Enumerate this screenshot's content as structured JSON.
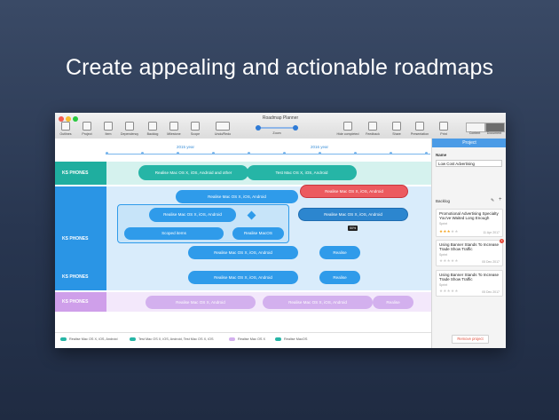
{
  "headline": "Create appealing and actionable roadmaps",
  "window": {
    "title": "Roadmap Planner"
  },
  "toolbar": {
    "outlines": "Outlines",
    "project": "Project",
    "item": "Item",
    "dependency": "Dependency",
    "backlog": "Backlog",
    "milestone": "Milestone",
    "scope": "Scope",
    "undo_redo": "Undo/Redo",
    "zoom": "Zoom",
    "hide_completed": "Hide completed",
    "feedback": "Feedback",
    "share": "Share",
    "presentation": "Presentation",
    "print": "Print",
    "content": "Content",
    "document": "Document"
  },
  "timeline": {
    "year1": "2015 year",
    "year2": "2016 year"
  },
  "lanes": {
    "ks1": {
      "label": "KS PHONES",
      "bar1": "Realise Mac OS X, iOS, Android and other",
      "bar2": "Test Mac OS X, iOS, Android"
    },
    "ks2": {
      "label": "KS PHONES",
      "bar_top": "Realise Mac OS X, iOS, Android",
      "bar_red": "Realise Mac OS X, iOS, Android",
      "bar_grp": "Realise Mac OS X, iOS, Android",
      "bar_sel": "Realise Mac OS X, iOS, Android",
      "scoped": "Scoped items",
      "macos": "Realise MacOS",
      "bar_bottom": "Realise Mac OS X, iOS, Android",
      "realise": "Realise",
      "percent_tag": "50%"
    },
    "ks3": {
      "label": "KS PHONES",
      "bar1": "Realise Mac OS X, iOS, Android",
      "bar2": "Realise"
    },
    "ks4": {
      "label": "KS PHONES",
      "bar1": "Realise Mac OS X, Android",
      "bar2": "Realise Mac OS X, iOS, Android",
      "bar3": "Realise"
    }
  },
  "legend": [
    {
      "label": "Realise Mac OS X, iOS, Android",
      "color": "#26b5a6"
    },
    {
      "label": "Test Mac OS X, iOS, Android, Test Mac OS X, iOS",
      "color": "#26b5a6"
    },
    {
      "label": "Realise Mac OS X",
      "color": "#d3b0ee"
    },
    {
      "label": "Realise MacOS",
      "color": "#26b5a6"
    }
  ],
  "panel": {
    "header": "Project",
    "name_label": "Name",
    "name_value": "Low Cost Advertising",
    "backlog_label": "Backlog",
    "cards": [
      {
        "title": "Promotional Advertising Specialty You've Waited Long Enough",
        "sub": "Sprint",
        "date": "11 Apr 2017",
        "stars": 3
      },
      {
        "title": "Using Banner Stands To Increase Trade Show Traffic",
        "sub": "Sprint",
        "date": "05 Dec 2017",
        "badge": "1"
      },
      {
        "title": "Using Banner Stands To Increase Trade Show Traffic",
        "sub": "Sprint",
        "date": "05 Dec 2017"
      }
    ],
    "remove_button": "Remove project"
  },
  "colors": {
    "teal": "#26b5a6",
    "blue": "#2f9bea",
    "red": "#ec5a5f",
    "lilac": "#d3b0ee",
    "accent": "#4b9be6"
  }
}
